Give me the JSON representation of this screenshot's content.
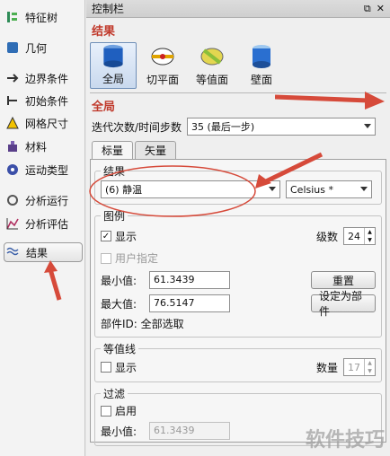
{
  "nav": [
    {
      "label": "特征树",
      "icon": "feature-tree-icon"
    },
    {
      "label": "几何",
      "icon": "geometry-icon"
    },
    {
      "label": "边界条件",
      "icon": "boundary-icon"
    },
    {
      "label": "初始条件",
      "icon": "initial-icon"
    },
    {
      "label": "网格尺寸",
      "icon": "mesh-icon"
    },
    {
      "label": "材料",
      "icon": "material-icon"
    },
    {
      "label": "运动类型",
      "icon": "motion-icon"
    },
    {
      "label": "分析运行",
      "icon": "run-icon"
    },
    {
      "label": "分析评估",
      "icon": "evaluate-icon"
    },
    {
      "label": "结果",
      "icon": "results-icon"
    }
  ],
  "panel": {
    "title": "控制栏",
    "title_controls": [
      "⧉",
      "✕"
    ],
    "section": "结果",
    "tools": [
      "全局",
      "切平面",
      "等值面",
      "壁面"
    ],
    "global_header": "全局",
    "iter_label": "迭代次数/时间步数",
    "iter_value": "35 (最后一步)",
    "tabs": [
      "标量",
      "矢量"
    ],
    "results_group": "结果",
    "result_value": "(6) 静温",
    "unit_value": "Celsius *",
    "legend_group": "图例",
    "show_label": "显示",
    "levels_label": "级数",
    "levels_value": "24",
    "user_spec_label": "用户指定",
    "min_label": "最小值:",
    "min_value": "61.3439",
    "max_label": "最大值:",
    "max_value": "76.5147",
    "reset_btn": "重置",
    "set_part_btn": "设定为部件",
    "part_id": "部件ID: 全部选取",
    "contour_group": "等值线",
    "contour_show": "显示",
    "count_label": "数量",
    "count_value": "17",
    "filter_group": "过滤",
    "filter_enable": "启用",
    "filter_min_label": "最小值:",
    "filter_min_value": "61.3439"
  },
  "watermark": "软件技巧",
  "colors": {
    "section_red": "#c0392b",
    "arrow_red": "#d64a3a",
    "active_blue": "#6f8fb8"
  }
}
